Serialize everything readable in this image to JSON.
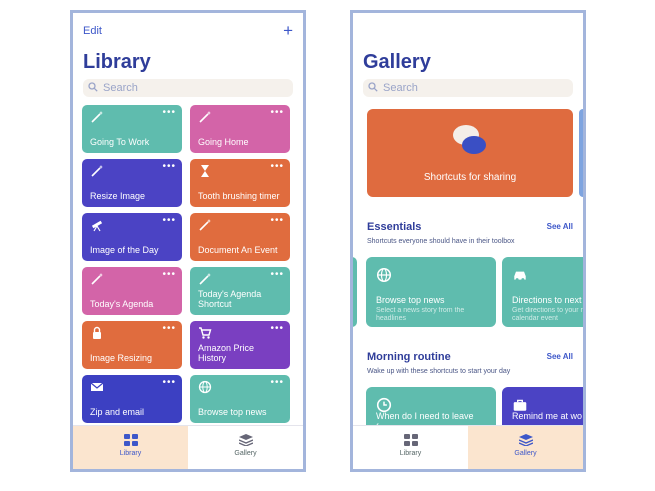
{
  "colors": {
    "accent": "#3d57c9",
    "title": "#2f3d9a",
    "frame_border": "#a3b5dc"
  },
  "library": {
    "edit_label": "Edit",
    "add_label": "+",
    "title": "Library",
    "search_placeholder": "Search",
    "more_label": "•••",
    "tiles": [
      {
        "label": "Going To Work",
        "color": "teal",
        "icon": "wand-icon"
      },
      {
        "label": "Going Home",
        "color": "pink",
        "icon": "wand-icon"
      },
      {
        "label": "Resize Image",
        "color": "indigo",
        "icon": "wand-icon"
      },
      {
        "label": "Tooth brushing timer",
        "color": "orange",
        "icon": "hourglass-icon"
      },
      {
        "label": "Image of the Day",
        "color": "indigo",
        "icon": "telescope-icon"
      },
      {
        "label": "Document An Event",
        "color": "orange",
        "icon": "wand-icon"
      },
      {
        "label": "Today's Agenda",
        "color": "pink",
        "icon": "wand-icon"
      },
      {
        "label": "Today's Agenda Shortcut",
        "color": "teal",
        "icon": "wand-icon"
      },
      {
        "label": "Image Resizing",
        "color": "orange",
        "icon": "lock-icon"
      },
      {
        "label": "Amazon Price History",
        "color": "purple",
        "icon": "cart-icon"
      },
      {
        "label": "Zip and email",
        "color": "navy",
        "icon": "envelope-icon"
      },
      {
        "label": "Browse top news",
        "color": "teal",
        "icon": "globe-icon"
      }
    ]
  },
  "gallery": {
    "title": "Gallery",
    "search_placeholder": "Search",
    "hero_label": "Shortcuts for sharing",
    "essentials": {
      "title": "Essentials",
      "see_all": "See All",
      "subtitle": "Shortcuts everyone should have in their toolbox",
      "cards": [
        {
          "label": "Browse top news",
          "sub": "Select a news story from the headlines",
          "color": "teal"
        },
        {
          "label": "Directions to next",
          "sub": "Get directions to your next calendar event",
          "color": "teal"
        }
      ]
    },
    "morning": {
      "title": "Morning routine",
      "see_all": "See All",
      "subtitle": "Wake up with these shortcuts to start your day",
      "cards": [
        {
          "label": "When do I need to leave for",
          "color": "teal"
        },
        {
          "label": "Remind me at wo",
          "color": "indigo"
        }
      ]
    }
  },
  "tabs": {
    "library": "Library",
    "gallery": "Gallery"
  }
}
